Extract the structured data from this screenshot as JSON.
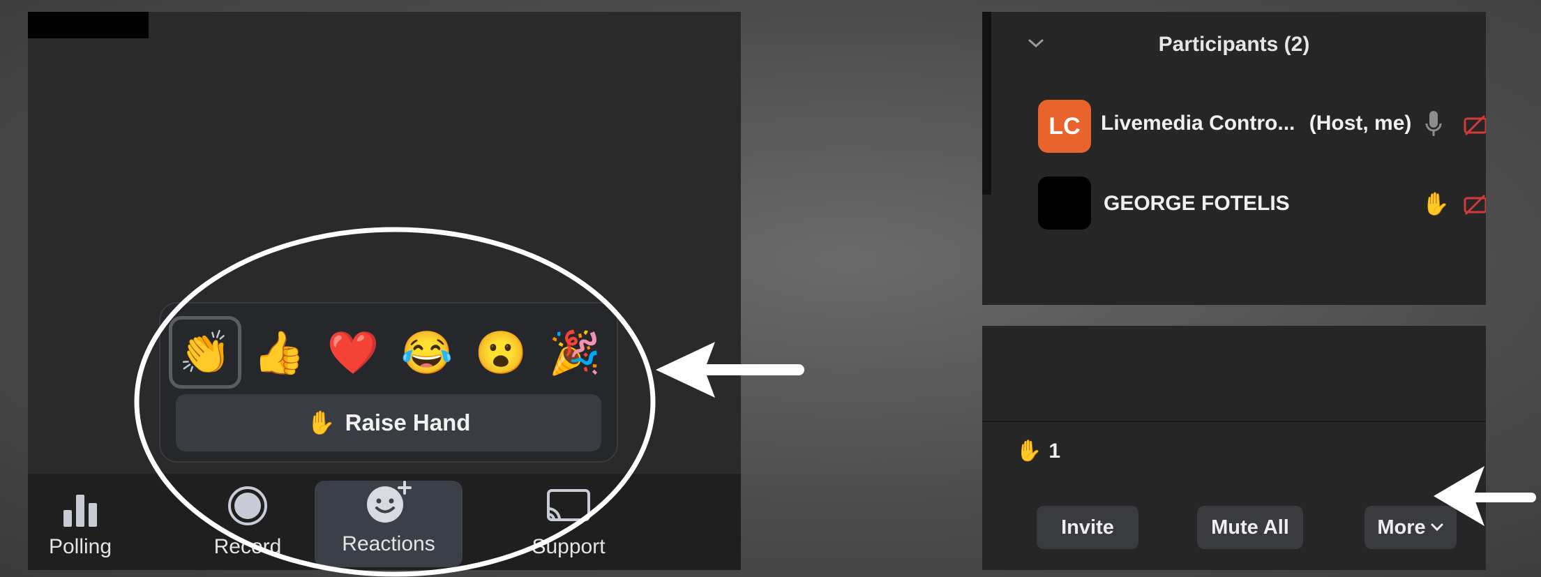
{
  "reactions": {
    "emojis": [
      {
        "name": "clapping-hands",
        "glyph": "👏"
      },
      {
        "name": "thumbs-up",
        "glyph": "👍"
      },
      {
        "name": "heart",
        "glyph": "❤️"
      },
      {
        "name": "tears-of-joy",
        "glyph": "😂"
      },
      {
        "name": "open-mouth",
        "glyph": "😮"
      },
      {
        "name": "party-popper",
        "glyph": "🎉"
      }
    ],
    "raise_hand_glyph": "✋",
    "raise_hand_label": "Raise Hand"
  },
  "toolbar": {
    "items": [
      {
        "label": "Polling",
        "icon": "bar-chart-icon"
      },
      {
        "label": "Record",
        "icon": "record-icon"
      },
      {
        "label": "Reactions",
        "icon": "reaction-smiley-icon"
      },
      {
        "label": "Support",
        "icon": "screen-cast-icon"
      }
    ]
  },
  "participants": {
    "title": "Participants (2)",
    "list": [
      {
        "initials": "LC",
        "name": "Livemedia Contro...",
        "role": "(Host, me)",
        "avatar_color": "#e8642c",
        "mic": "mic-icon",
        "video": "video-off-icon"
      },
      {
        "initials": "",
        "name": "GEORGE FOTELIS",
        "role": "",
        "avatar_color": "#000000",
        "hand": "✋",
        "video": "video-off-icon"
      }
    ]
  },
  "bottom": {
    "raised_hand_glyph": "✋",
    "raised_hand_count": "1",
    "buttons": {
      "invite": "Invite",
      "mute_all": "Mute All",
      "more": "More"
    }
  },
  "colors": {
    "accent_orange": "#e8642c",
    "video_off_red": "#d23a3a",
    "annotation_white": "#ffffff"
  }
}
